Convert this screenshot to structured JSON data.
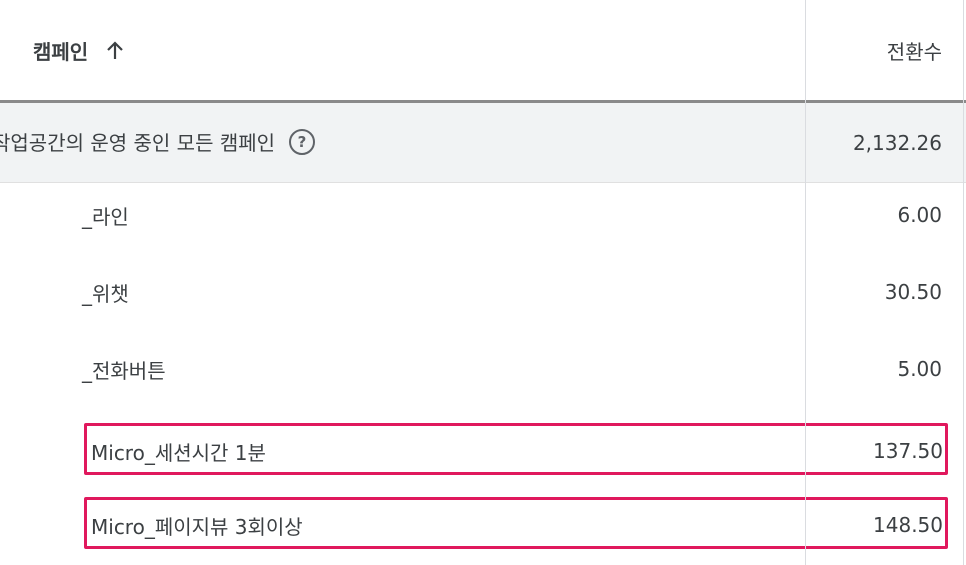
{
  "header": {
    "campaign_label": "캠페인",
    "sort_icon": "arrow-up-icon",
    "conversions_label": "전환수"
  },
  "total": {
    "label": "작업공간의 운영 중인 모든 캠페인",
    "help_icon": "help-circle-icon",
    "help_glyph": "?",
    "value": "2,132.26"
  },
  "rows": [
    {
      "label": "_라인",
      "value": "6.00"
    },
    {
      "label": "_위챗",
      "value": "30.50"
    },
    {
      "label": "_전화버튼",
      "value": "5.00"
    },
    {
      "label": "Micro_세션시간 1분",
      "value": "137.50",
      "highlighted": true
    },
    {
      "label": "Micro_페이지뷰 3회이상",
      "value": "148.50",
      "highlighted": true
    }
  ],
  "colors": {
    "highlight_border": "#e0185d",
    "total_row_bg": "#f1f3f4",
    "header_rule": "#8a8a8a"
  }
}
